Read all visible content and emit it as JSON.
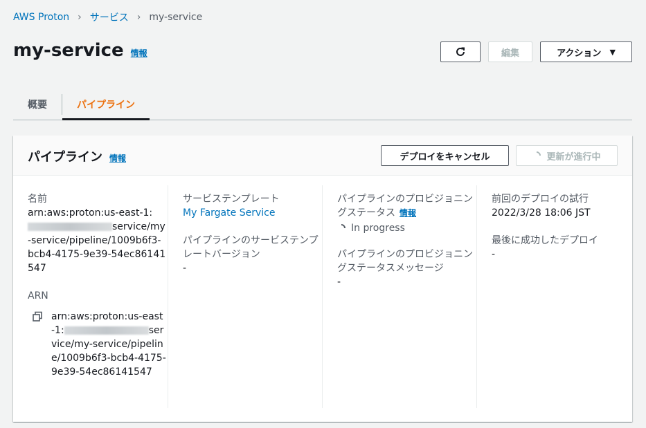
{
  "breadcrumb": {
    "root": "AWS Proton",
    "section": "サービス",
    "current": "my-service"
  },
  "page": {
    "title": "my-service",
    "info": "情報"
  },
  "header_actions": {
    "refresh_icon": "refresh-icon",
    "edit_label": "編集",
    "action_label": "アクション"
  },
  "tabs": [
    {
      "label": "概要",
      "active": false
    },
    {
      "label": "パイプライン",
      "active": true
    }
  ],
  "card": {
    "title": "パイプライン",
    "info": "情報",
    "cancel_deploy_label": "デプロイをキャンセル",
    "update_in_progress_label": "更新が進行中"
  },
  "fields": {
    "name_label": "名前",
    "name_value_prefix": "arn:aws:proton:us-east-1:",
    "name_value_suffix": "service/my-service/pipeline/1009b6f3-bcb4-4175-9e39-54ec86141547",
    "arn_label": "ARN",
    "arn_value_prefix": "arn:aws:proton:us-east-1:",
    "arn_value_suffix": "service/my-service/pipeline/1009b6f3-bcb4-4175-9e39-54ec86141547",
    "service_template_label": "サービステンプレート",
    "service_template_value": "My Fargate Service",
    "pipeline_template_version_label": "パイプラインのサービステンプレートバージョン",
    "pipeline_template_version_value": "-",
    "provisioning_status_label": "パイプラインのプロビジョニングステータス",
    "provisioning_status_info": "情報",
    "provisioning_status_value": "In progress",
    "provisioning_message_label": "パイプラインのプロビジョニングステータスメッセージ",
    "provisioning_message_value": "-",
    "last_deploy_attempt_label": "前回のデプロイの試行",
    "last_deploy_attempt_value": "2022/3/28 18:06 JST",
    "last_success_deploy_label": "最後に成功したデプロイ",
    "last_success_deploy_value": "-"
  }
}
